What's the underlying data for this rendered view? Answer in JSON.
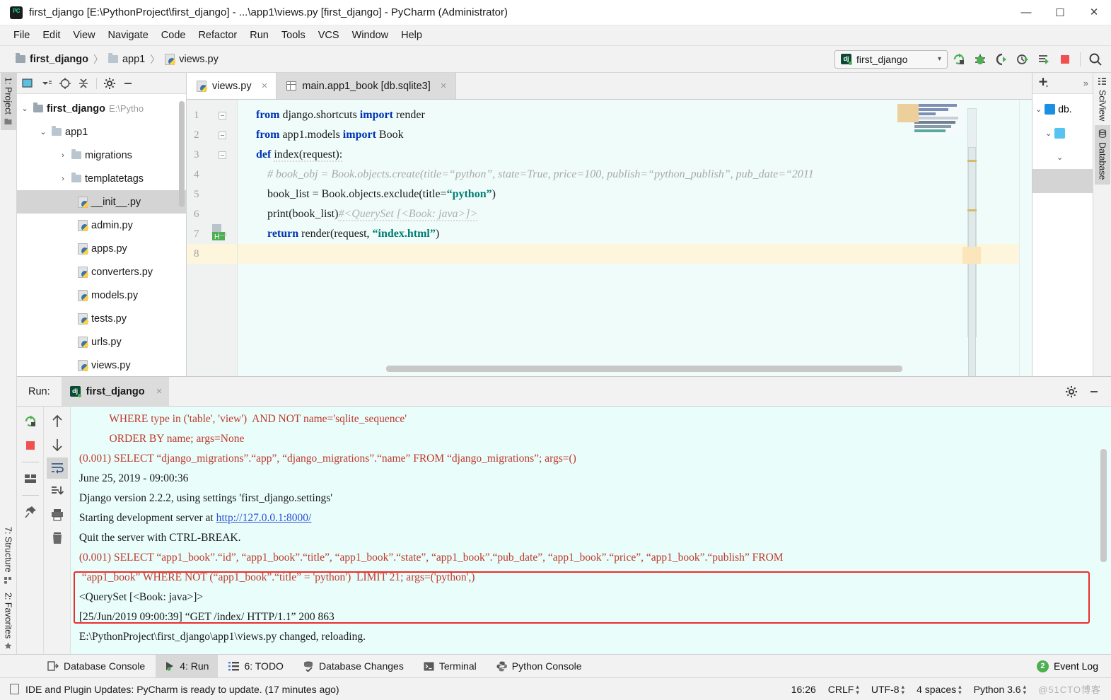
{
  "window": {
    "title": "first_django [E:\\PythonProject\\first_django] - ...\\app1\\views.py [first_django] - PyCharm (Administrator)",
    "minimize": "—",
    "maximize": "☐",
    "close": "×"
  },
  "menubar": {
    "items": [
      "File",
      "Edit",
      "View",
      "Navigate",
      "Code",
      "Refactor",
      "Run",
      "Tools",
      "VCS",
      "Window",
      "Help"
    ]
  },
  "navbar": {
    "breadcrumb": [
      "first_django",
      "app1",
      "views.py"
    ],
    "separator": "〉",
    "run_config": "first_django",
    "icons": [
      "run-icon",
      "debug-icon",
      "coverage-icon",
      "profile-icon",
      "run-with-console-icon",
      "stop-icon",
      "search-everywhere-icon"
    ]
  },
  "left_strip": {
    "project_tab": "1: Project",
    "structure_tab": "7: Structure",
    "favorites_tab": "2: Favorites"
  },
  "project": {
    "toolbar_icons": [
      "select-opened-file-icon",
      "view-options-icon",
      "locate-icon",
      "collapse-all-icon",
      "settings-icon",
      "hide-icon"
    ],
    "tree": [
      {
        "indent": 0,
        "arrow": "⌄",
        "icon": "folder-icon",
        "name": "first_django",
        "bold": true,
        "sub": "E:\\Pytho",
        "selected": false
      },
      {
        "indent": 1,
        "arrow": "⌄",
        "icon": "module-folder-icon",
        "name": "app1",
        "bold": false,
        "sub": "",
        "selected": false
      },
      {
        "indent": 2,
        "arrow": "›",
        "icon": "module-folder-icon",
        "name": "migrations",
        "bold": false,
        "sub": "",
        "selected": false
      },
      {
        "indent": 2,
        "arrow": "›",
        "icon": "module-folder-icon",
        "name": "templatetags",
        "bold": false,
        "sub": "",
        "selected": false
      },
      {
        "indent": 3,
        "arrow": "",
        "icon": "python-file-icon",
        "name": "__init__.py",
        "bold": false,
        "sub": "",
        "selected": true
      },
      {
        "indent": 3,
        "arrow": "",
        "icon": "python-file-icon",
        "name": "admin.py",
        "bold": false,
        "sub": "",
        "selected": false
      },
      {
        "indent": 3,
        "arrow": "",
        "icon": "python-file-icon",
        "name": "apps.py",
        "bold": false,
        "sub": "",
        "selected": false
      },
      {
        "indent": 3,
        "arrow": "",
        "icon": "python-file-icon",
        "name": "converters.py",
        "bold": false,
        "sub": "",
        "selected": false
      },
      {
        "indent": 3,
        "arrow": "",
        "icon": "python-file-icon",
        "name": "models.py",
        "bold": false,
        "sub": "",
        "selected": false
      },
      {
        "indent": 3,
        "arrow": "",
        "icon": "python-file-icon",
        "name": "tests.py",
        "bold": false,
        "sub": "",
        "selected": false
      },
      {
        "indent": 3,
        "arrow": "",
        "icon": "python-file-icon",
        "name": "urls.py",
        "bold": false,
        "sub": "",
        "selected": false
      },
      {
        "indent": 3,
        "arrow": "",
        "icon": "python-file-icon",
        "name": "views.py",
        "bold": false,
        "sub": "",
        "selected": false
      }
    ]
  },
  "editor": {
    "tabs": [
      {
        "label": "views.py",
        "icon": "python-file-icon",
        "active": true,
        "close": "×"
      },
      {
        "label": "main.app1_book [db.sqlite3]",
        "icon": "table-icon",
        "active": false,
        "close": "×"
      }
    ],
    "line_numbers": [
      "1",
      "2",
      "3",
      "4",
      "5",
      "6",
      "7",
      "8"
    ],
    "current_line": 8,
    "code": [
      {
        "n": 1,
        "tokens": [
          {
            "t": "from ",
            "c": "kw"
          },
          {
            "t": "django.shortcuts ",
            "c": "id"
          },
          {
            "t": "import ",
            "c": "kw"
          },
          {
            "t": "render",
            "c": "id"
          }
        ]
      },
      {
        "n": 2,
        "tokens": [
          {
            "t": "from ",
            "c": "kw"
          },
          {
            "t": "app1.models ",
            "c": "id"
          },
          {
            "t": "import ",
            "c": "kw"
          },
          {
            "t": "Book",
            "c": "id"
          }
        ]
      },
      {
        "n": 3,
        "tokens": [
          {
            "t": "def ",
            "c": "kw"
          },
          {
            "t": "index(request):",
            "c": "id"
          }
        ]
      },
      {
        "n": 4,
        "tokens": [
          {
            "t": "    # book_obj = Book.objects.create(title=“python”, state=True, price=100, publish=“python_publish”, pub_date=“2011",
            "c": "cmt"
          }
        ]
      },
      {
        "n": 5,
        "tokens": [
          {
            "t": "    book_list = Book.objects.exclude(title=",
            "c": "id"
          },
          {
            "t": "“python”",
            "c": "str"
          },
          {
            "t": ")",
            "c": "id"
          }
        ]
      },
      {
        "n": 6,
        "tokens": [
          {
            "t": "    print(book_list)",
            "c": "id"
          },
          {
            "t": "#<QuerySet [<Book: java>]>",
            "c": "cmt-w"
          }
        ]
      },
      {
        "n": 7,
        "tokens": [
          {
            "t": "    return ",
            "c": "kw"
          },
          {
            "t": "render(request, ",
            "c": "id"
          },
          {
            "t": "“index.html”",
            "c": "str"
          },
          {
            "t": ")",
            "c": "id"
          }
        ]
      },
      {
        "n": 8,
        "tokens": [
          {
            "t": "",
            "c": "id"
          }
        ]
      }
    ]
  },
  "right_strip": {
    "sciview_tab": "SciView",
    "database_tab": "Database"
  },
  "database_panel": {
    "add_icon": "plus-icon",
    "expand_icon": "»",
    "rows": [
      {
        "arrow": "⌄",
        "icon": "db-icon",
        "name": "db."
      },
      {
        "arrow": "⌄",
        "icon": "schema-icon",
        "name": ""
      },
      {
        "arrow": "⌄",
        "icon": "",
        "name": ""
      },
      {
        "arrow": "",
        "icon": "",
        "name": ""
      }
    ]
  },
  "run_window": {
    "label": "Run:",
    "tab": "first_django",
    "tab_close": "×",
    "settings_icon": "gear-icon",
    "hide_icon": "hide-icon",
    "toolbar_left": [
      "rerun-icon",
      "stop-icon",
      "layout-icon",
      "pin-icon"
    ],
    "toolbar_right": [
      "up-icon",
      "down-icon",
      "soft-wrap-icon",
      "scroll-to-end-icon",
      "print-icon",
      "clear-all-icon"
    ],
    "console": [
      {
        "text": "            WHERE type in ('table', 'view')  AND NOT name='sqlite_sequence'",
        "style": "sql"
      },
      {
        "text": "            ORDER BY name; args=None",
        "style": "sql"
      },
      {
        "text": " (0.001) SELECT “django_migrations”.“app”, “django_migrations”.“name” FROM “django_migrations”; args=()",
        "style": "sql"
      },
      {
        "text": " June 25, 2019 - 09:00:36",
        "style": "plain"
      },
      {
        "text": " Django version 2.2.2, using settings 'first_django.settings'",
        "style": "plain"
      },
      {
        "text": " Starting development server at ",
        "style": "plain",
        "link": "http://127.0.0.1:8000/"
      },
      {
        "text": " Quit the server with CTRL-BREAK.",
        "style": "plain"
      },
      {
        "text": " (0.001) SELECT “app1_book”.“id”, “app1_book”.“title”, “app1_book”.“state”, “app1_book”.“pub_date”, “app1_book”.“price”, “app1_book”.“publish” FROM",
        "style": "sql"
      },
      {
        "text": "  “app1_book” WHERE NOT (“app1_book”.“title” = 'python')  LIMIT 21; args=('python',)",
        "style": "sql"
      },
      {
        "text": " <QuerySet [<Book: java>]>",
        "style": "plain"
      },
      {
        "text": " [25/Jun/2019 09:00:39] “GET /index/ HTTP/1.1” 200 863",
        "style": "plain"
      },
      {
        "text": " E:\\PythonProject\\first_django\\app1\\views.py changed, reloading.",
        "style": "plain"
      }
    ],
    "highlight_color": "#ee2b2b"
  },
  "bottom_bar": {
    "tabs": [
      {
        "label": "Database Console",
        "icon": "database-console-icon",
        "selected": false,
        "num": ""
      },
      {
        "label": "4: Run",
        "icon": "run-icon",
        "selected": true,
        "num": "4"
      },
      {
        "label": "6: TODO",
        "icon": "todo-icon",
        "selected": false,
        "num": "6"
      },
      {
        "label": "Database Changes",
        "icon": "database-changes-icon",
        "selected": false,
        "num": ""
      },
      {
        "label": "Terminal",
        "icon": "terminal-icon",
        "selected": false,
        "num": ""
      },
      {
        "label": "Python Console",
        "icon": "python-console-icon",
        "selected": false,
        "num": ""
      }
    ],
    "event_log": "Event Log",
    "event_count": "2"
  },
  "status_bar": {
    "message": "IDE and Plugin Updates: PyCharm is ready to update. (17 minutes ago)",
    "caret": "16:26",
    "line_separator": "CRLF",
    "encoding": "UTF-8",
    "indent": "4 spaces",
    "interpreter": "Python 3.6",
    "watermark": "@51CTO博客"
  }
}
